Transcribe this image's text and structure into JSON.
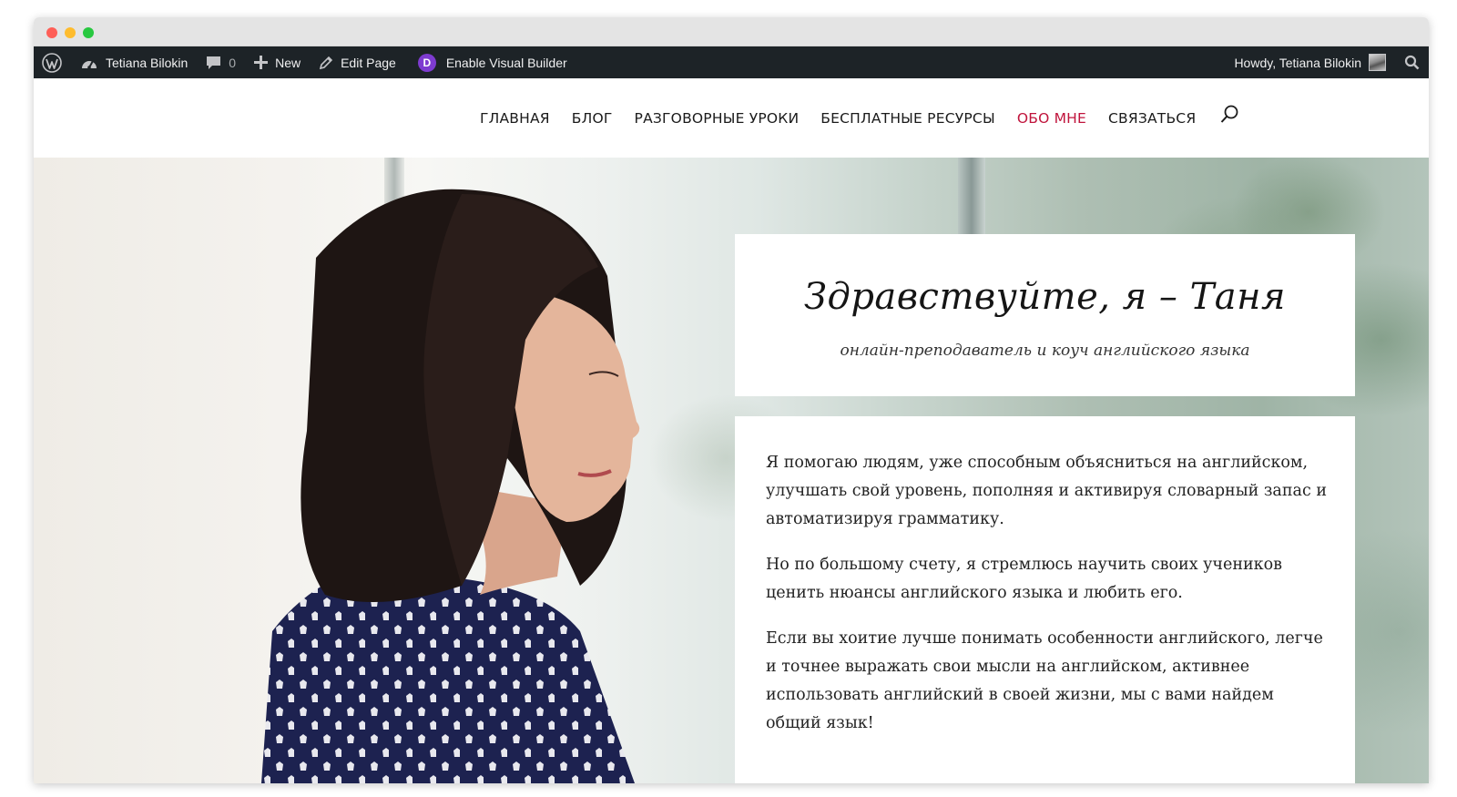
{
  "admin_bar": {
    "site_name": "Tetiana Bilokin",
    "comments_count": "0",
    "new_label": "New",
    "edit_page_label": "Edit Page",
    "divi_letter": "D",
    "visual_builder_label": "Enable Visual Builder",
    "howdy_label": "Howdy, Tetiana Bilokin"
  },
  "nav": {
    "items": [
      {
        "label": "ГЛАВНАЯ",
        "active": false
      },
      {
        "label": "БЛОГ",
        "active": false
      },
      {
        "label": "РАЗГОВОРНЫЕ УРОКИ",
        "active": false
      },
      {
        "label": "БЕСПЛАТНЫЕ РЕСУРСЫ",
        "active": false
      },
      {
        "label": "ОБО МНЕ",
        "active": true
      },
      {
        "label": "СВЯЗАТЬСЯ",
        "active": false
      }
    ],
    "active_color": "#c0143c",
    "search_icon": "search-icon"
  },
  "hero": {
    "title": "Здравствуйте, я – Таня",
    "subtitle": "онлайн-преподаватель и коуч английского языка",
    "paragraphs": [
      "Я помогаю людям, уже способным объясниться на английском, улучшать свой уровень, пополняя и активируя словарный запас и автоматизируя грамматику.",
      "Но по большому счету, я стремлюсь научить своих учеников ценить нюансы английского языка и любить его.",
      "Если вы хоитие лучше понимать особенности английского, легче и точнее выражать свои мысли на английском, активнее использовать английский в своей жизни, мы с вами найдем общий язык!"
    ]
  },
  "colors": {
    "admin_bar_bg": "#1d2327",
    "divi_purple": "#7e3bd0",
    "accent": "#c0143c"
  }
}
